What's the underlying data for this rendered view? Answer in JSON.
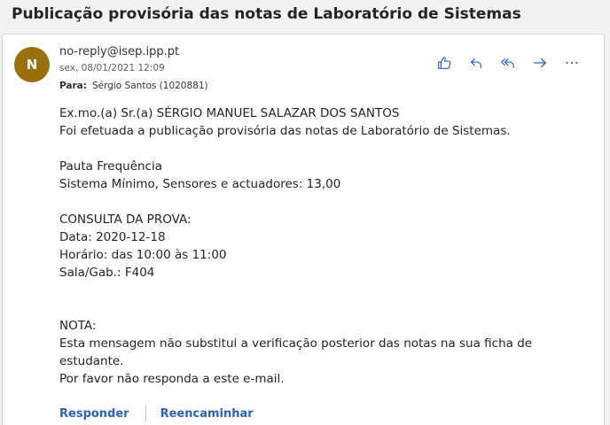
{
  "subject": "Publicação provisória das notas de Laboratório de Sistemas",
  "message": {
    "avatar_initial": "N",
    "sender": "no-reply@isep.ipp.pt",
    "date": "sex, 08/01/2021 12:09",
    "to_label": "Para:",
    "to_value": "Sérgio Santos (1020881)",
    "body_lines": [
      "Ex.mo.(a) Sr.(a) SÉRGIO MANUEL SALAZAR DOS SANTOS",
      "Foi efetuada a publicação provisória das notas de Laboratório de Sistemas.",
      "",
      "Pauta Frequência",
      "Sistema Mínimo, Sensores e actuadores: 13,00",
      "",
      "CONSULTA DA PROVA:",
      "Data: 2020-12-18",
      "Horário: das 10:00 às 11:00",
      "Sala/Gab.: F404",
      "",
      "",
      "NOTA:",
      "Esta mensagem não substitui a verificação posterior das notas na sua ficha de",
      "estudante.",
      "Por favor não responda a este e-mail."
    ]
  },
  "actions": {
    "like_icon": "thumbs-up-icon",
    "reply_icon": "reply-icon",
    "reply_all_icon": "reply-all-icon",
    "forward_icon": "forward-icon",
    "more_icon": "more-icon"
  },
  "footer": {
    "reply_label": "Responder",
    "forward_label": "Reencaminhar"
  },
  "colors": {
    "accent": "#2b63b6",
    "avatar_bg": "#986f0b",
    "background": "#f3f2f1"
  }
}
